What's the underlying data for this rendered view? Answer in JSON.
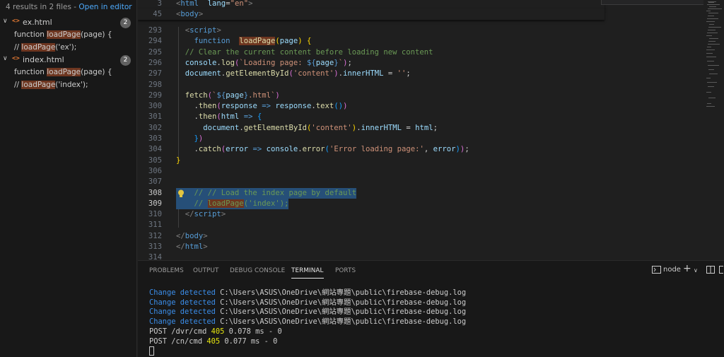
{
  "search": {
    "summary": "4 results in 2 files - ",
    "open_in_editor": "Open in editor",
    "files": [
      {
        "name": "ex.html",
        "count": "2",
        "matches": [
          {
            "pre": "function ",
            "hit": "loadPage",
            "post": "(page) {"
          },
          {
            "pre": "// ",
            "hit": "loadPage",
            "post": "('ex');"
          }
        ]
      },
      {
        "name": "index.html",
        "count": "2",
        "matches": [
          {
            "pre": "function ",
            "hit": "loadPage",
            "post": "(page) {"
          },
          {
            "pre": "// ",
            "hit": "loadPage",
            "post": "('index');"
          }
        ]
      }
    ]
  },
  "editor": {
    "sticky": [
      {
        "num": "3",
        "parts": [
          [
            "punc",
            "<"
          ],
          [
            "tag",
            "html"
          ],
          [
            "",
            "  "
          ],
          [
            "attr",
            "lang"
          ],
          [
            "",
            "="
          ],
          [
            "str",
            "\"en\""
          ],
          [
            "punc",
            ">"
          ]
        ]
      },
      {
        "num": "45",
        "parts": [
          [
            "punc",
            "<"
          ],
          [
            "tag",
            "body"
          ],
          [
            "punc",
            ">"
          ]
        ]
      }
    ],
    "lines": [
      {
        "num": "293",
        "parts": [
          [
            "",
            "  "
          ],
          [
            "punc",
            "<"
          ],
          [
            "tag",
            "script"
          ],
          [
            "punc",
            ">"
          ]
        ]
      },
      {
        "num": "294",
        "parts": [
          [
            "",
            "    "
          ],
          [
            "kw",
            "function"
          ],
          [
            "",
            "  "
          ],
          [
            "fn hitbg",
            "loadPage"
          ],
          [
            "br1",
            "("
          ],
          [
            "var",
            "page"
          ],
          [
            "br1",
            ")"
          ],
          [
            "",
            " "
          ],
          [
            "br1",
            "{"
          ]
        ]
      },
      {
        "num": "295",
        "parts": [
          [
            "",
            "  "
          ],
          [
            "com",
            "// Clear the current content before loading new content"
          ]
        ]
      },
      {
        "num": "296",
        "parts": [
          [
            "",
            "  "
          ],
          [
            "var",
            "console"
          ],
          [
            "",
            "."
          ],
          [
            "fn",
            "log"
          ],
          [
            "br2",
            "("
          ],
          [
            "str",
            "`Loading page: "
          ],
          [
            "kw",
            "${"
          ],
          [
            "var",
            "page"
          ],
          [
            "kw",
            "}"
          ],
          [
            "str",
            "`"
          ],
          [
            "br2",
            ")"
          ],
          [
            "",
            ";"
          ]
        ]
      },
      {
        "num": "297",
        "parts": [
          [
            "",
            "  "
          ],
          [
            "var",
            "document"
          ],
          [
            "",
            "."
          ],
          [
            "fn",
            "getElementById"
          ],
          [
            "br2",
            "("
          ],
          [
            "str",
            "'content'"
          ],
          [
            "br2",
            ")"
          ],
          [
            "",
            "."
          ],
          [
            "var",
            "innerHTML"
          ],
          [
            "",
            " = "
          ],
          [
            "str",
            "''"
          ],
          [
            "",
            ";"
          ]
        ]
      },
      {
        "num": "298",
        "parts": []
      },
      {
        "num": "299",
        "parts": [
          [
            "",
            "  "
          ],
          [
            "fn",
            "fetch"
          ],
          [
            "br2",
            "("
          ],
          [
            "str",
            "`"
          ],
          [
            "kw",
            "${"
          ],
          [
            "var",
            "page"
          ],
          [
            "kw",
            "}"
          ],
          [
            "str",
            ".html`"
          ],
          [
            "br2",
            ")"
          ]
        ]
      },
      {
        "num": "300",
        "parts": [
          [
            "",
            "    ."
          ],
          [
            "fn",
            "then"
          ],
          [
            "br2",
            "("
          ],
          [
            "var",
            "response"
          ],
          [
            "",
            " "
          ],
          [
            "kw",
            "=>"
          ],
          [
            "",
            " "
          ],
          [
            "var",
            "response"
          ],
          [
            "",
            "."
          ],
          [
            "fn",
            "text"
          ],
          [
            "br3",
            "()"
          ],
          [
            "br2",
            ")"
          ]
        ]
      },
      {
        "num": "301",
        "parts": [
          [
            "",
            "    ."
          ],
          [
            "fn",
            "then"
          ],
          [
            "br2",
            "("
          ],
          [
            "var",
            "html"
          ],
          [
            "",
            " "
          ],
          [
            "kw",
            "=>"
          ],
          [
            "",
            " "
          ],
          [
            "br3",
            "{"
          ]
        ]
      },
      {
        "num": "302",
        "parts": [
          [
            "",
            "      "
          ],
          [
            "var",
            "document"
          ],
          [
            "",
            "."
          ],
          [
            "fn",
            "getElementById"
          ],
          [
            "br1",
            "("
          ],
          [
            "str",
            "'content'"
          ],
          [
            "br1",
            ")"
          ],
          [
            "",
            "."
          ],
          [
            "var",
            "innerHTML"
          ],
          [
            "",
            " = "
          ],
          [
            "var",
            "html"
          ],
          [
            "",
            ";"
          ]
        ]
      },
      {
        "num": "303",
        "parts": [
          [
            "",
            "    "
          ],
          [
            "br3",
            "}"
          ],
          [
            "br2",
            ")"
          ]
        ]
      },
      {
        "num": "304",
        "parts": [
          [
            "",
            "    ."
          ],
          [
            "fn",
            "catch"
          ],
          [
            "br2",
            "("
          ],
          [
            "var",
            "error"
          ],
          [
            "",
            " "
          ],
          [
            "kw",
            "=>"
          ],
          [
            "",
            " "
          ],
          [
            "var",
            "console"
          ],
          [
            "",
            "."
          ],
          [
            "fn",
            "error"
          ],
          [
            "br3",
            "("
          ],
          [
            "str",
            "'Error loading page:'"
          ],
          [
            "",
            ", "
          ],
          [
            "var",
            "error"
          ],
          [
            "br3",
            ")"
          ],
          [
            "br2",
            ")"
          ],
          [
            "",
            ";"
          ]
        ]
      },
      {
        "num": "305",
        "parts": [
          [
            "br1",
            "}"
          ]
        ]
      },
      {
        "num": "306",
        "parts": []
      },
      {
        "num": "307",
        "parts": []
      },
      {
        "num": "308",
        "parts": [
          [
            "com",
            "    // // Load the index page by default"
          ]
        ],
        "sel": true
      },
      {
        "num": "309",
        "parts": [
          [
            "com",
            "    // "
          ],
          [
            "com hitbg",
            "loadPage"
          ],
          [
            "com",
            "('index');"
          ]
        ],
        "sel": true
      },
      {
        "num": "310",
        "parts": [
          [
            "",
            "  "
          ],
          [
            "punc",
            "</"
          ],
          [
            "tag",
            "script"
          ],
          [
            "punc",
            ">"
          ]
        ]
      },
      {
        "num": "311",
        "parts": []
      },
      {
        "num": "312",
        "parts": [
          [
            "punc",
            "</"
          ],
          [
            "tag",
            "body"
          ],
          [
            "punc",
            ">"
          ]
        ]
      },
      {
        "num": "313",
        "parts": [
          [
            "punc",
            "</"
          ],
          [
            "tag",
            "html"
          ],
          [
            "punc",
            ">"
          ]
        ]
      },
      {
        "num": "314",
        "parts": []
      }
    ]
  },
  "panel": {
    "tabs": [
      "PROBLEMS",
      "OUTPUT",
      "DEBUG CONSOLE",
      "TERMINAL",
      "PORTS"
    ],
    "active_tab": "TERMINAL",
    "shell": "node",
    "terminal_lines": [
      {
        "parts": [
          [
            "blue",
            "Change detected "
          ],
          [
            "",
            "C:\\Users\\ASUS\\OneDrive\\網站專題\\public\\firebase-debug.log"
          ]
        ]
      },
      {
        "parts": [
          [
            "blue",
            "Change detected "
          ],
          [
            "",
            "C:\\Users\\ASUS\\OneDrive\\網站專題\\public\\firebase-debug.log"
          ]
        ]
      },
      {
        "parts": [
          [
            "blue",
            "Change detected "
          ],
          [
            "",
            "C:\\Users\\ASUS\\OneDrive\\網站專題\\public\\firebase-debug.log"
          ]
        ]
      },
      {
        "parts": [
          [
            "blue",
            "Change detected "
          ],
          [
            "",
            "C:\\Users\\ASUS\\OneDrive\\網站專題\\public\\firebase-debug.log"
          ]
        ]
      },
      {
        "parts": [
          [
            "",
            "POST /dvr/cmd "
          ],
          [
            "yel",
            "405"
          ],
          [
            "",
            " 0.078 ms - 0"
          ]
        ]
      },
      {
        "parts": [
          [
            "",
            "POST /cn/cmd "
          ],
          [
            "yel",
            "405"
          ],
          [
            "",
            " 0.077 ms - 0"
          ]
        ]
      }
    ]
  },
  "icons": {
    "collapse": "chevron-down-icon",
    "html_file": "html-file-icon",
    "lightbulb": "lightbulb-icon",
    "terminal": "terminal-icon",
    "add": "plus-icon",
    "split": "split-terminal-icon",
    "layout": "panel-layout-icon"
  },
  "colors": {
    "accent": "#4daafc",
    "match_highlight": "#6e3620",
    "selection": "#264f78",
    "terminal_blue": "#3b8eea",
    "terminal_yellow": "#e5e510"
  }
}
